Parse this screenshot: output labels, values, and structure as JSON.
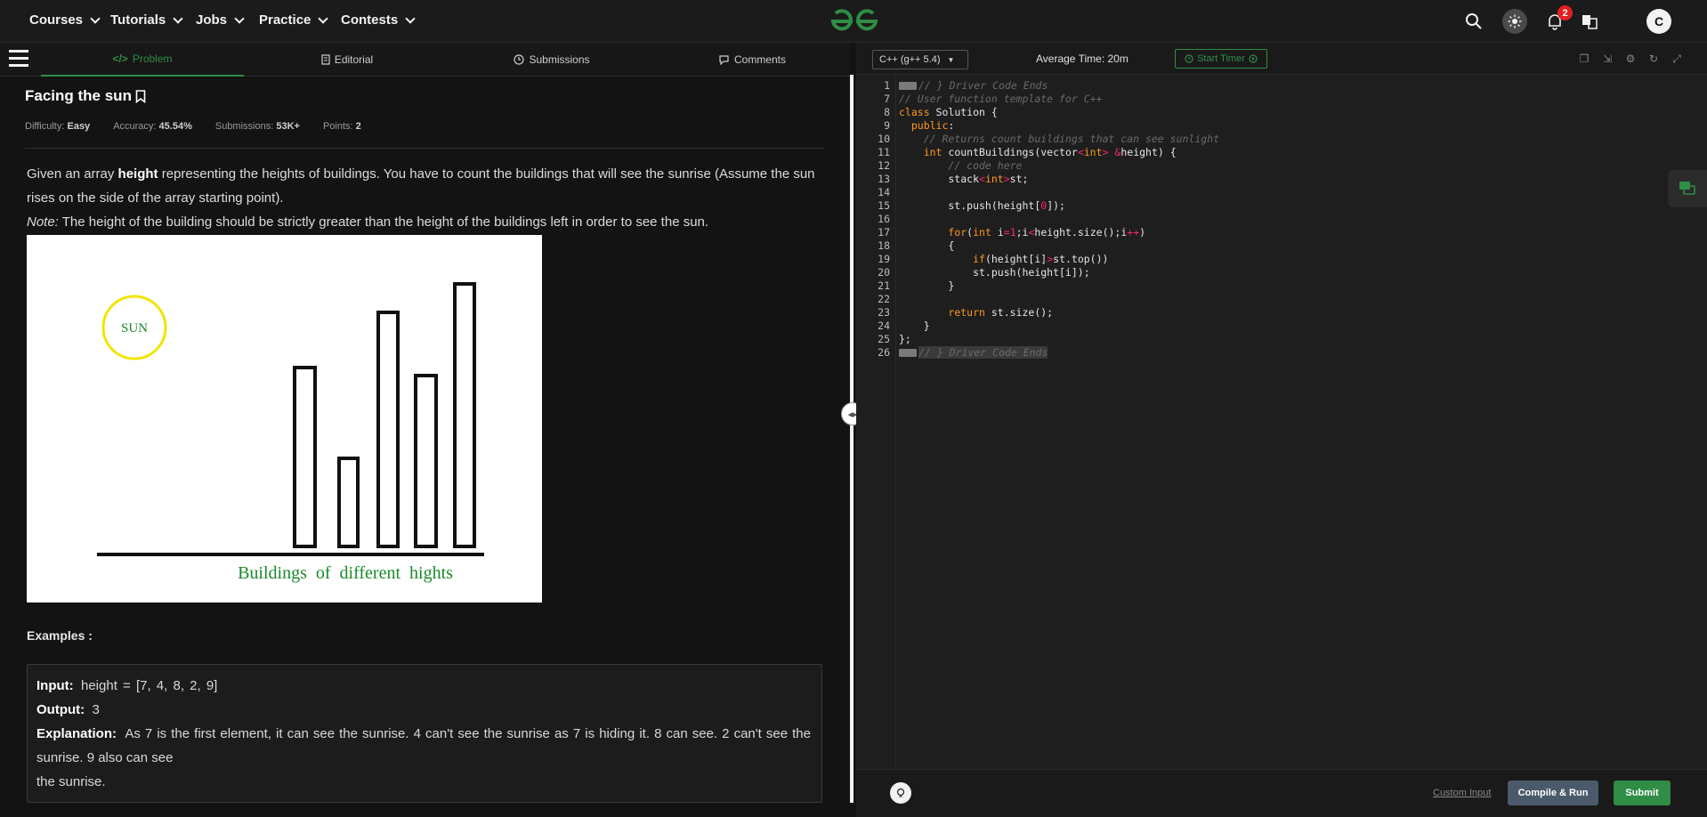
{
  "nav": {
    "items": [
      "Courses",
      "Tutorials",
      "Jobs",
      "Practice",
      "Contests"
    ],
    "notification_count": "2",
    "avatar_initial": "C"
  },
  "tabs": [
    "Problem",
    "Editorial",
    "Submissions",
    "Comments"
  ],
  "problem": {
    "title": "Facing the sun",
    "difficulty_label": "Difficulty:",
    "difficulty": "Easy",
    "accuracy_label": "Accuracy:",
    "accuracy": "45.54%",
    "submissions_label": "Submissions:",
    "submissions": "53K+",
    "points_label": "Points:",
    "points": "2",
    "desc_prefix": "Given an array ",
    "desc_bold": "height",
    "desc_rest": " representing the heights of buildings. You have to count the buildings that will see the sunrise (Assume the sun rises on the side of the array starting point).",
    "note_label": "Note:",
    "note_text": " The height of the building should be strictly greater than the height of the buildings left in order to see the sun.",
    "figure": {
      "sun_label": "SUN",
      "caption": "Buildings  of  different  hights"
    },
    "examples_heading": "Examples :",
    "example": {
      "input_label": "Input:",
      "input": "height = [7, 4, 8, 2, 9]",
      "output_label": "Output:",
      "output": "3",
      "explanation_label": "Explanation:",
      "explanation_1": "As 7 is the first element, it can see the sunrise. 4 can't see the sunrise as 7 is hiding it. 8 can see. 2 can't see the sunrise. 9 also can see",
      "explanation_2": "the sunrise."
    }
  },
  "editor": {
    "language": "C++ (g++ 5.4)",
    "avg_time": "Average Time: 20m",
    "start_timer": "Start Timer",
    "custom_input": "Custom Input",
    "compile_run": "Compile & Run",
    "submit": "Submit",
    "line_numbers": [
      "1",
      "7",
      "8",
      "9",
      "10",
      "11",
      "12",
      "13",
      "14",
      "15",
      "16",
      "17",
      "18",
      "19",
      "20",
      "21",
      "22",
      "23",
      "24",
      "25",
      "26"
    ]
  },
  "colors": {
    "accent": "#2f8d46",
    "background": "#131313",
    "editor_bg": "#1e1e1e"
  }
}
